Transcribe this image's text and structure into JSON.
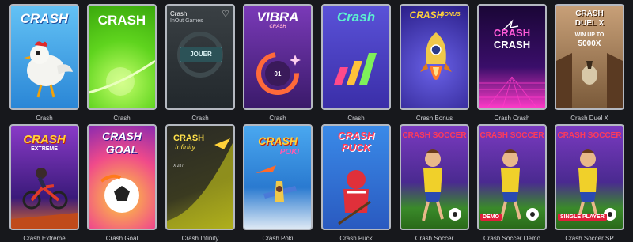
{
  "games": [
    {
      "caption": "Crash",
      "title": "CRASH",
      "bg": "#3aa0e8"
    },
    {
      "caption": "Crash",
      "title": "CRASH",
      "bg": "#4dd01a"
    },
    {
      "caption": "Crash",
      "title": "Crash",
      "provider": "InOut Games",
      "button": "JOUER",
      "bg": "#2b3236"
    },
    {
      "caption": "Crash",
      "title": "VIBRA",
      "subtitle": "CRASH",
      "counter": "01",
      "bg": "#5a2a8a"
    },
    {
      "caption": "Crash",
      "title": "Crash",
      "bg": "#4d40c8"
    },
    {
      "caption": "Crash Bonus",
      "title": "CRASH",
      "subtitle": "BONUS",
      "bg": "#3a2e9a"
    },
    {
      "caption": "Crash Crash",
      "title": "CRASH",
      "subtitle": "CRASH",
      "bg": "#2a0a56"
    },
    {
      "caption": "Crash Duel X",
      "title": "CRASH",
      "subtitle": "DUEL X",
      "win": "WIN UP TO",
      "win_value": "5000X",
      "bg": "#8a6a48"
    },
    {
      "caption": "Crash Extreme",
      "title": "CRASH",
      "subtitle": "EXTREME",
      "bg": "#7a2fb0"
    },
    {
      "caption": "Crash Goal",
      "title": "CRASH",
      "subtitle": "GOAL",
      "bg": "#d84a8a"
    },
    {
      "caption": "Crash Infinity",
      "title": "CRASH",
      "subtitle": "Infinity",
      "multiplier": "X 287",
      "bg": "#24231c"
    },
    {
      "caption": "Crash Poki",
      "title": "CRASH",
      "subtitle": "POKI",
      "bg": "#2a86d8"
    },
    {
      "caption": "Crash Puck",
      "title": "CRASH",
      "subtitle": "PUCK",
      "bg": "#2a6ad0"
    },
    {
      "caption": "Crash Soccer",
      "title": "CRASH SOCCER",
      "bg": "#6a3ab0"
    },
    {
      "caption": "Crash Soccer Demo",
      "title": "CRASH SOCCER",
      "badge": "DEMO",
      "bg": "#6a3ab0"
    },
    {
      "caption": "Crash Soccer SP",
      "title": "CRASH SOCCER",
      "badge": "SINGLE PLAYER",
      "bg": "#6a3ab0"
    }
  ],
  "colors": {
    "page_bg": "#17181c",
    "card_border": "#b4b8c0",
    "caption": "#d0d2d6"
  }
}
